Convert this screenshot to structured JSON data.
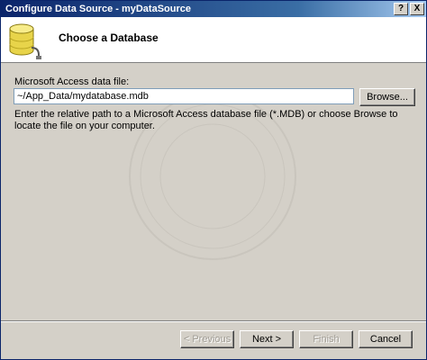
{
  "window": {
    "title": "Configure Data Source - myDataSource",
    "help_glyph": "?",
    "close_glyph": "X"
  },
  "header": {
    "title": "Choose a Database",
    "icon": "database-icon"
  },
  "form": {
    "label": "Microsoft Access data file:",
    "path_value": "~/App_Data/mydatabase.mdb",
    "browse_label": "Browse...",
    "help_text": "Enter the relative path to a Microsoft Access database file (*.MDB) or choose Browse to locate the file on your computer."
  },
  "buttons": {
    "previous": "< Previous",
    "next": "Next >",
    "finish": "Finish",
    "cancel": "Cancel"
  },
  "colors": {
    "titlebar_start": "#0a246a",
    "titlebar_end": "#a6caf0",
    "dialog_bg": "#d4d0c8",
    "db_yellow": "#e8d44a"
  }
}
